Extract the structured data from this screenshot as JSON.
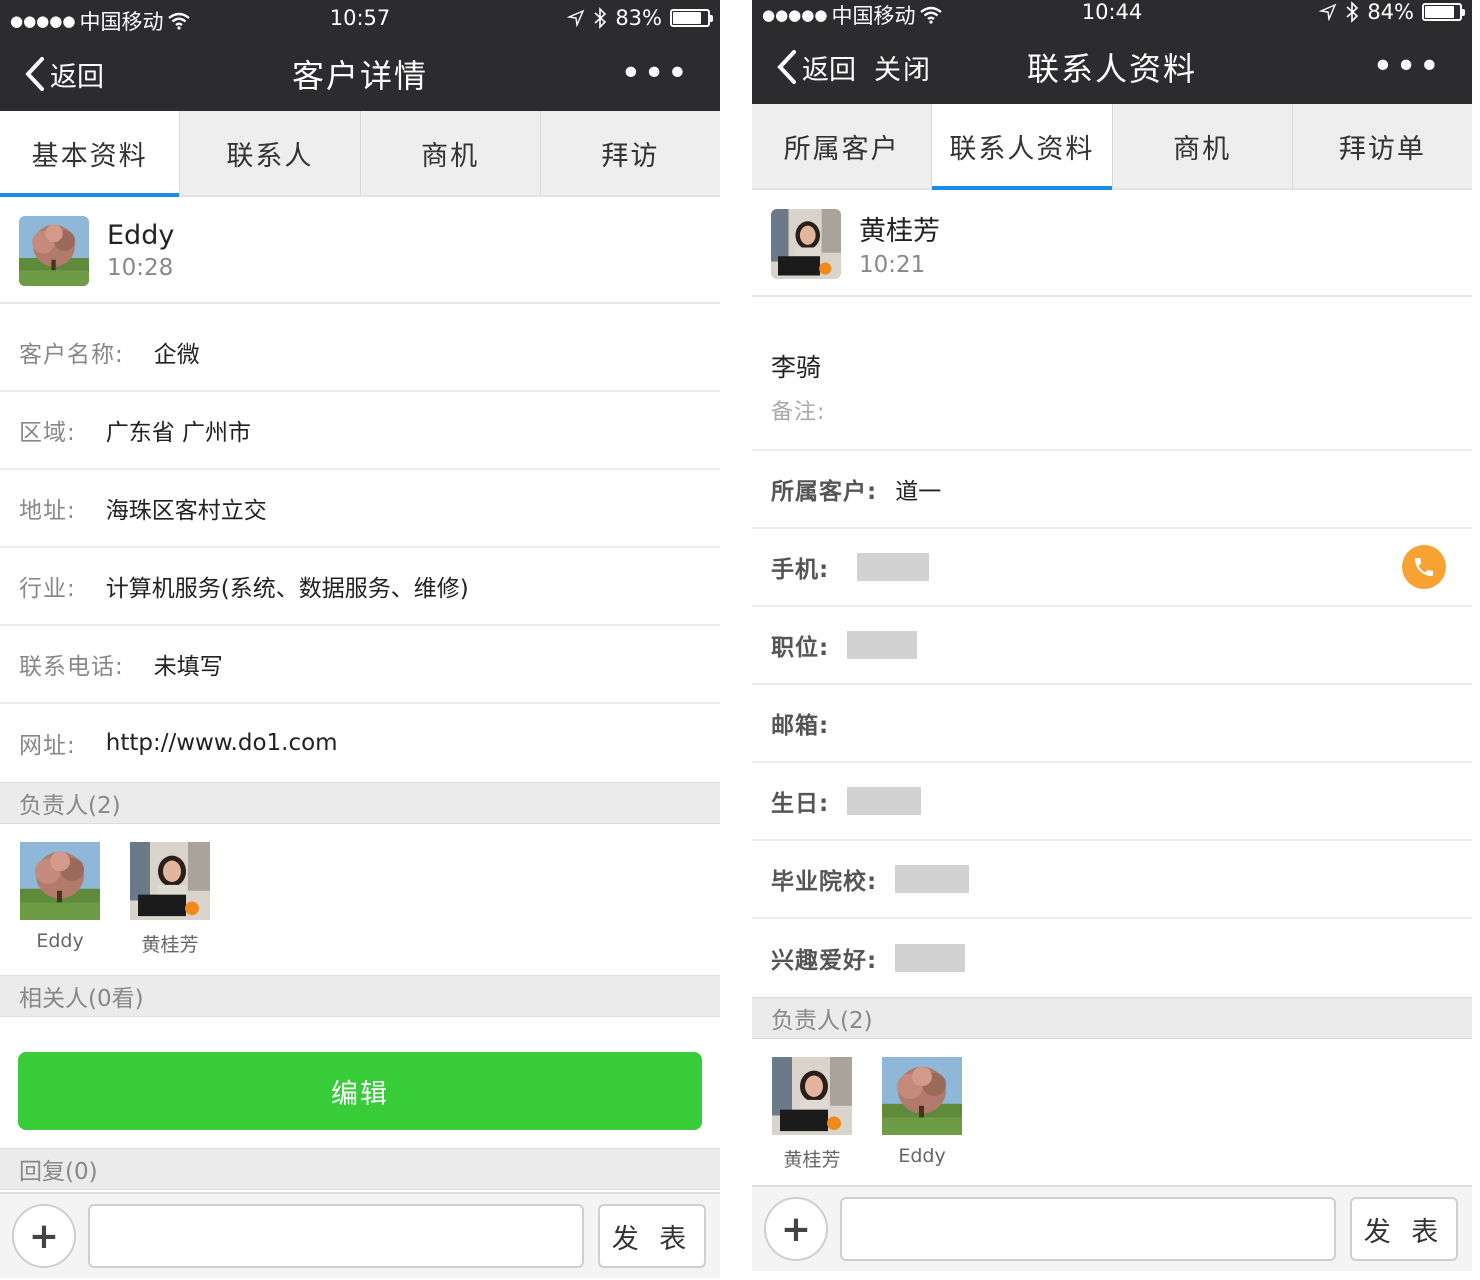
{
  "left": {
    "status": {
      "signal": "●●●●●",
      "carrier": "中国移动",
      "time": "10:57",
      "battery_text": "83%",
      "battery_level": 0.83
    },
    "nav": {
      "back_label": "返回",
      "title": "客户详情",
      "more": "•••"
    },
    "tabs": [
      {
        "label": "基本资料",
        "active": true
      },
      {
        "label": "联系人",
        "active": false
      },
      {
        "label": "商机",
        "active": false
      },
      {
        "label": "拜访",
        "active": false
      }
    ],
    "poster": {
      "name": "Eddy",
      "time": "10:28"
    },
    "fields": [
      {
        "label": "客户名称:",
        "value": "企微"
      },
      {
        "label": "区域:",
        "value": "广东省 广州市"
      },
      {
        "label": "地址:",
        "value": "海珠区客村立交"
      },
      {
        "label": "行业:",
        "value": "计算机服务(系统、数据服务、维修)"
      },
      {
        "label": "联系电话:",
        "value": "未填写"
      },
      {
        "label": "网址:",
        "value": "http://www.do1.com"
      }
    ],
    "owners_header": "负责人(2)",
    "owners": [
      {
        "name": "Eddy"
      },
      {
        "name": "黄桂芳"
      }
    ],
    "related_header": "相关人(0看)",
    "edit_label": "编辑",
    "reply_header": "回复(0)",
    "compose": {
      "plus": "+",
      "input_value": "",
      "send_label": "发 表"
    }
  },
  "right": {
    "status": {
      "signal": "●●●●●",
      "carrier": "中国移动",
      "time": "10:44",
      "battery_text": "84%",
      "battery_level": 0.84
    },
    "nav": {
      "back_label": "返回",
      "close_label": "关闭",
      "title": "联系人资料",
      "more": "•••"
    },
    "tabs": [
      {
        "label": "所属客户",
        "active": false
      },
      {
        "label": "联系人资料",
        "active": true
      },
      {
        "label": "商机",
        "active": false
      },
      {
        "label": "拜访单",
        "active": false
      }
    ],
    "poster": {
      "name": "黄桂芳",
      "time": "10:21"
    },
    "contact_name": "李骑",
    "remark_label": "备注:",
    "fields": [
      {
        "label": "所属客户:",
        "value": "道一"
      },
      {
        "label": "手机:",
        "value": ""
      },
      {
        "label": "职位:",
        "value": ""
      },
      {
        "label": "邮箱:",
        "value": ""
      },
      {
        "label": "生日:",
        "value": ""
      },
      {
        "label": "毕业院校:",
        "value": ""
      },
      {
        "label": "兴趣爱好:",
        "value": ""
      }
    ],
    "owners_header": "负责人(2)",
    "owners": [
      {
        "name": "黄桂芳"
      },
      {
        "name": "Eddy"
      }
    ],
    "compose": {
      "plus": "+",
      "input_value": "",
      "send_label": "发 表"
    }
  },
  "colors": {
    "navbar": "#2c2c2e",
    "tab_active_underline": "#1a8ee2",
    "edit_button": "#38cc38",
    "call_button": "#f7a233"
  },
  "icons": {
    "back": "chevron-left-icon",
    "more": "more-dots-icon",
    "wifi": "wifi-icon",
    "location": "location-arrow-icon",
    "bluetooth": "bluetooth-icon",
    "battery": "battery-icon",
    "phone": "phone-icon",
    "plus": "plus-icon"
  }
}
